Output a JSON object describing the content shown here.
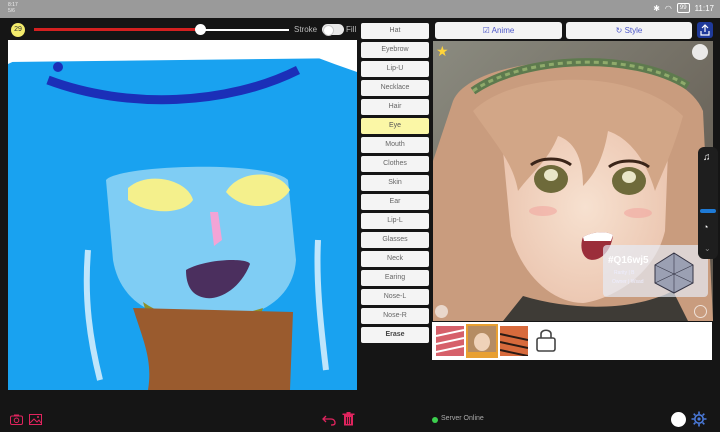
{
  "status_bar": {
    "time_left": "8:17",
    "date_left": "5/6",
    "battery": "99",
    "time": "11:17"
  },
  "toolbar": {
    "brush_size": "29",
    "stroke_level": 0.65,
    "stroke_label": "Stroke",
    "fill_label": "Fill"
  },
  "parts": [
    {
      "label": "Hat"
    },
    {
      "label": "Eyebrow"
    },
    {
      "label": "Lip-U"
    },
    {
      "label": "Necklace"
    },
    {
      "label": "Hair"
    },
    {
      "label": "Eye"
    },
    {
      "label": "Mouth"
    },
    {
      "label": "Clothes"
    },
    {
      "label": "Skin"
    },
    {
      "label": "Ear"
    },
    {
      "label": "Lip-L"
    },
    {
      "label": "Glasses"
    },
    {
      "label": "Neck"
    },
    {
      "label": "Earing"
    },
    {
      "label": "Nose-L"
    },
    {
      "label": "Nose-R"
    },
    {
      "label": "Erase"
    }
  ],
  "selected_part": "Eye",
  "preview": {
    "anime_label": "Anime",
    "style_label": "Style",
    "card_code": "#Q16wj5",
    "card_rarity": "Rarity | B",
    "card_owner": "Owner | Wsad"
  },
  "server_status": "Server Online",
  "colors": {
    "accent": "#e0245e",
    "slider_fill": "#d42020",
    "selected_part": "#fbf7a6",
    "preview_button_text": "#4b56c8",
    "server_online": "#3ccf4e",
    "canvas_hair": "#19a2f0",
    "canvas_skin": "#6fc7f2"
  }
}
